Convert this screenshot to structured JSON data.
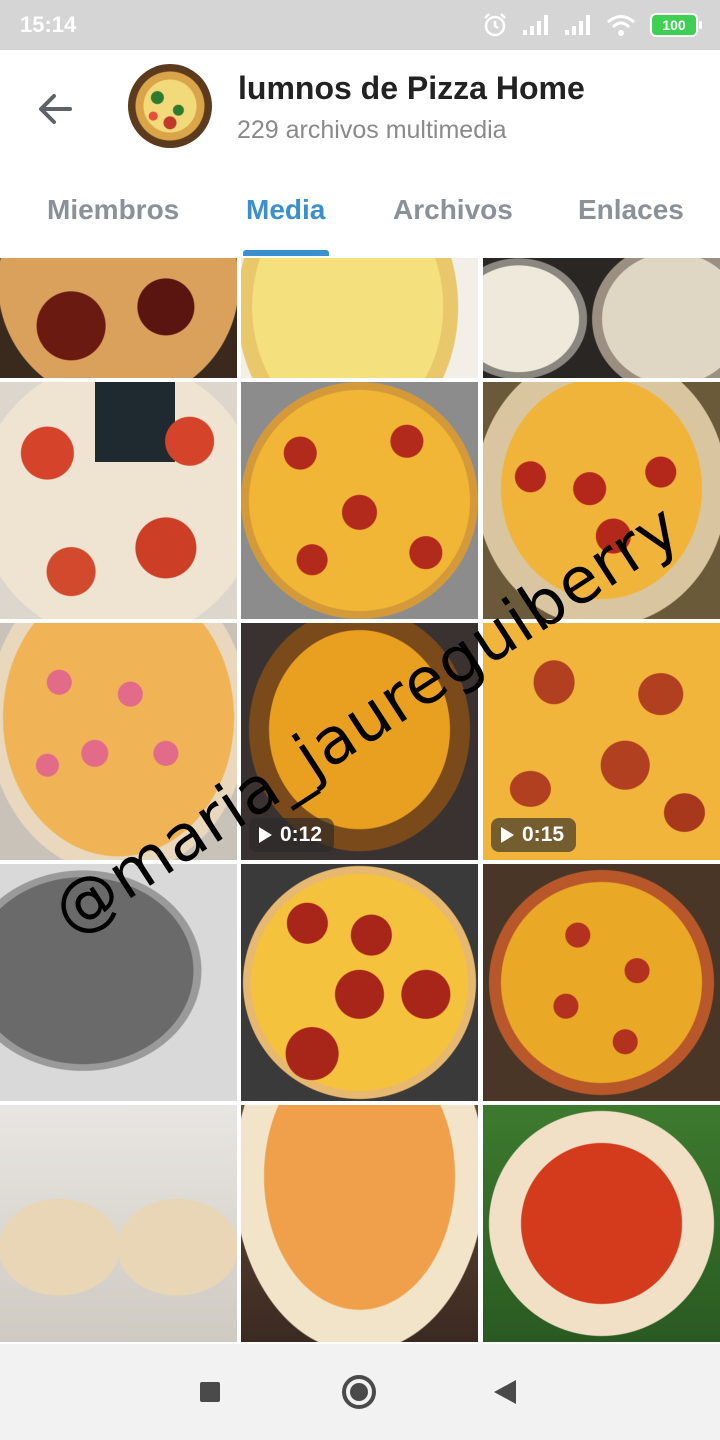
{
  "status_bar": {
    "time": "15:14",
    "battery": "100",
    "icons": [
      "alarm-icon",
      "signal-icon",
      "signal-icon",
      "wifi-icon",
      "battery-icon"
    ]
  },
  "header": {
    "title": "lumnos de Pizza Home",
    "subtitle": "229 archivos multimedia"
  },
  "tabs": [
    {
      "label": "Miembros",
      "active": false
    },
    {
      "label": "Media",
      "active": true
    },
    {
      "label": "Archivos",
      "active": false
    },
    {
      "label": "Enlaces",
      "active": false
    }
  ],
  "media": [
    {
      "kind": "photo",
      "description": "pepperoni pizza"
    },
    {
      "kind": "photo",
      "description": "olive pizza in box"
    },
    {
      "kind": "photo",
      "description": "flour in bowl"
    },
    {
      "kind": "photo",
      "description": "tomato pizza with flyer"
    },
    {
      "kind": "photo",
      "description": "pepperoni basil pizza"
    },
    {
      "kind": "photo",
      "description": "pepperoni basil pizza"
    },
    {
      "kind": "photo",
      "description": "ham and sausage pizza"
    },
    {
      "kind": "video",
      "duration": "0:12"
    },
    {
      "kind": "video",
      "duration": "0:15"
    },
    {
      "kind": "photo",
      "description": "pizza pan"
    },
    {
      "kind": "photo",
      "description": "pepperoni pizza"
    },
    {
      "kind": "photo",
      "description": "vegetable pizza"
    },
    {
      "kind": "photo",
      "description": "calzones"
    },
    {
      "kind": "photo",
      "description": "stacked pizza bases"
    },
    {
      "kind": "photo",
      "description": "pizza bases with sauce"
    }
  ],
  "watermark": "@maria_jaureguiberry",
  "colors": {
    "accent": "#3b8fcf",
    "status_bar_bg": "#d5d5d5",
    "battery": "#3fcf53",
    "nav_bar_bg": "#f2f2f2"
  },
  "nav_bar": {
    "icons": [
      "recent-apps-icon",
      "home-icon",
      "back-icon"
    ]
  }
}
